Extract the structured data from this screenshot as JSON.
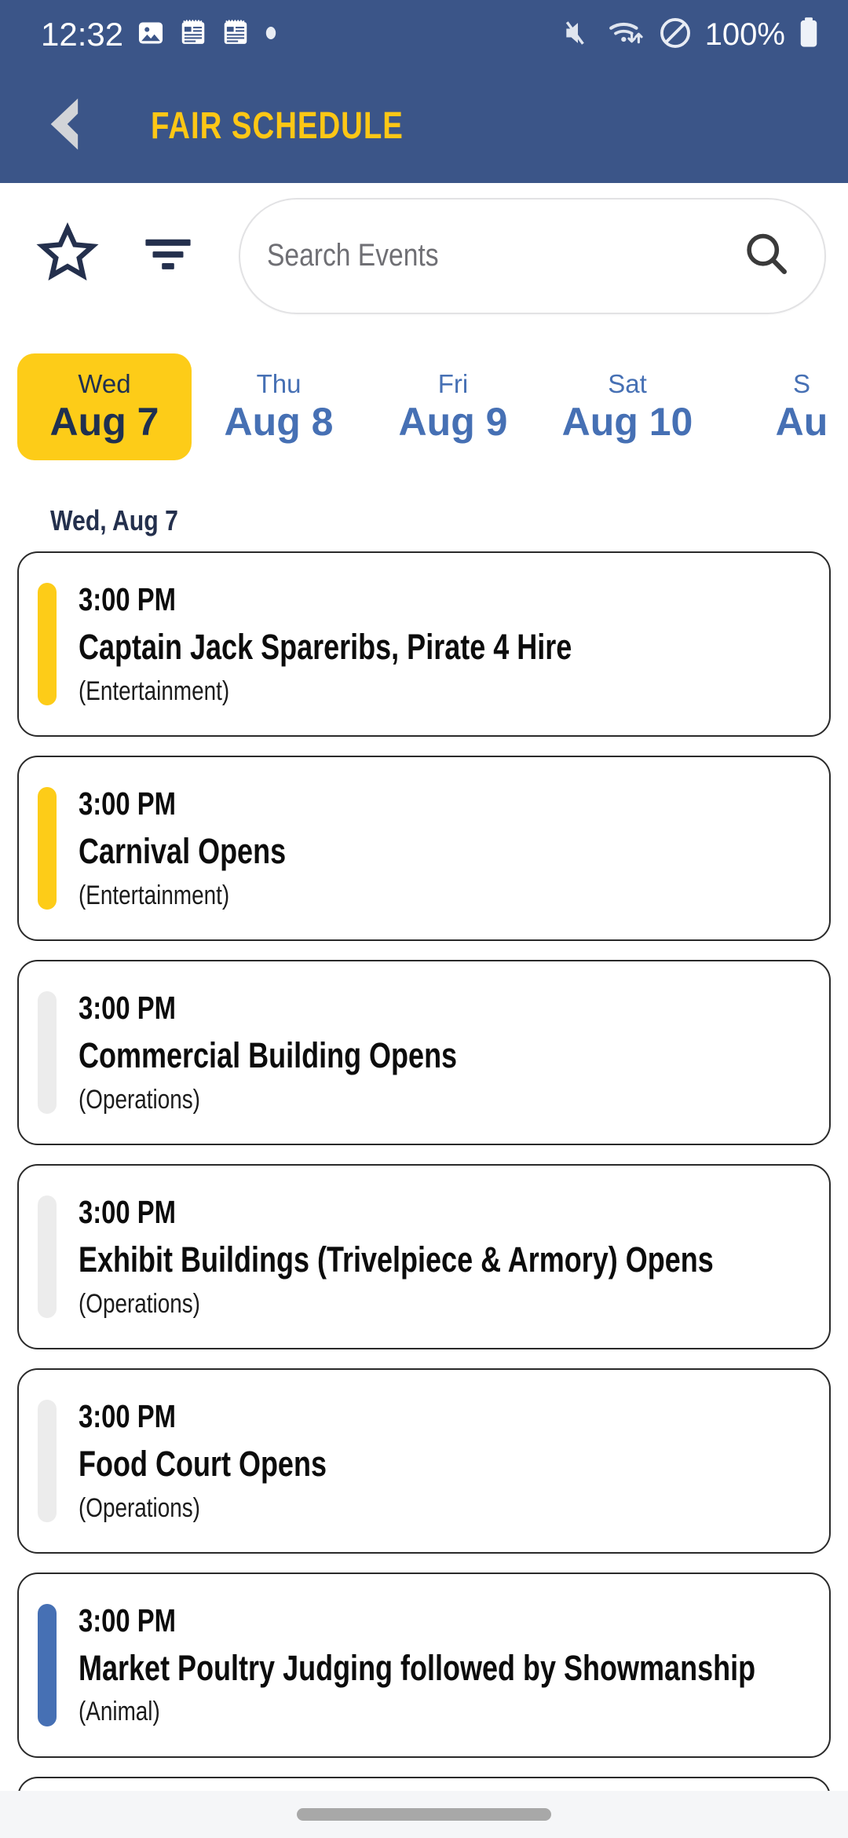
{
  "status_bar": {
    "clock": "12:32",
    "battery_text": "100%",
    "left_icons": [
      "image-icon",
      "calendar-note-icon",
      "calendar-note-icon",
      "dot-icon"
    ],
    "right_icons": [
      "volume-muted-icon",
      "wifi-icon",
      "do-not-disturb-icon",
      "battery-full-icon"
    ]
  },
  "app_bar": {
    "back_icon": "chevron-left-icon",
    "title": "FAIR SCHEDULE",
    "background_color": "#3b5588",
    "title_color": "#fdc715"
  },
  "toolbar": {
    "favorites_icon": "star-outline-icon",
    "filter_icon": "filter-icon",
    "search_icon": "search-icon",
    "search_placeholder": "Search Events",
    "search_value": ""
  },
  "day_tabs": {
    "selected_index": 0,
    "items": [
      {
        "day_of_week": "Wed",
        "date": "Aug 7",
        "active": true
      },
      {
        "day_of_week": "Thu",
        "date": "Aug 8",
        "active": false
      },
      {
        "day_of_week": "Fri",
        "date": "Aug 9",
        "active": false
      },
      {
        "day_of_week": "Sat",
        "date": "Aug 10",
        "active": false
      },
      {
        "day_of_week": "S",
        "date": "Au",
        "active": false
      }
    ],
    "active_background": "#fdcc18",
    "active_text_color": "#1f3050",
    "inactive_text_color": "#4670b4"
  },
  "schedule": {
    "date_header": "Wed, Aug 7",
    "accent_colors": {
      "Entertainment": "#fdcc18",
      "Operations": "#ececec",
      "Animal": "#4670b4"
    },
    "events": [
      {
        "time": "3:00 PM",
        "title": "Captain Jack Spareribs, Pirate 4 Hire",
        "category": "(Entertainment)",
        "accent": "#fdcc18"
      },
      {
        "time": "3:00 PM",
        "title": "Carnival Opens",
        "category": "(Entertainment)",
        "accent": "#fdcc18"
      },
      {
        "time": "3:00 PM",
        "title": "Commercial Building Opens",
        "category": "(Operations)",
        "accent": "#ececec"
      },
      {
        "time": "3:00 PM",
        "title": "Exhibit Buildings (Trivelpiece & Armory) Opens",
        "category": "(Operations)",
        "accent": "#ececec"
      },
      {
        "time": "3:00 PM",
        "title": "Food Court Opens",
        "category": "(Operations)",
        "accent": "#ececec"
      },
      {
        "time": "3:00 PM",
        "title": "Market Poultry Judging followed by Showmanship",
        "category": "(Animal)",
        "accent": "#4670b4"
      }
    ]
  },
  "nav_bar": {
    "home_indicator": "home-indicator"
  }
}
